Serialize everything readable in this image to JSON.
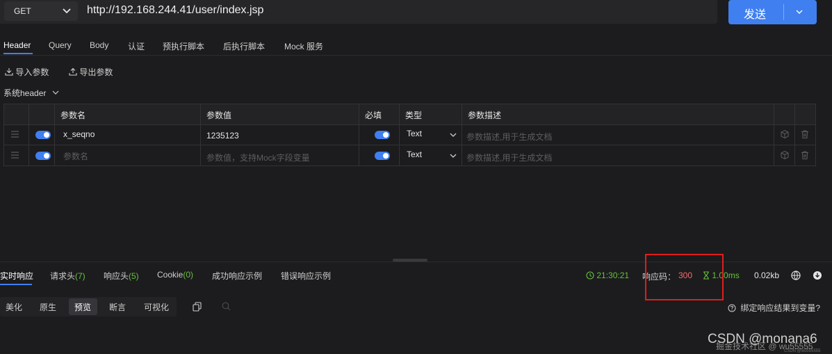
{
  "request": {
    "method": "GET",
    "url": "http://192.168.244.41/user/index.jsp",
    "send_label": "发送"
  },
  "tabs": [
    "Header",
    "Query",
    "Body",
    "认证",
    "预执行脚本",
    "后执行脚本",
    "Mock 服务"
  ],
  "actions": {
    "import_label": "导入参数",
    "export_label": "导出参数"
  },
  "system_header_label": "系统header",
  "table": {
    "headers": {
      "name": "参数名",
      "value": "参数值",
      "required": "必填",
      "type": "类型",
      "desc": "参数描述"
    },
    "rows": [
      {
        "name": "x_seqno",
        "value": "1235123",
        "type": "Text",
        "desc_placeholder": "参数描述,用于生成文档"
      },
      {
        "name_placeholder": "参数名",
        "value_placeholder": "参数值，支持Mock字段变量",
        "type": "Text",
        "desc_placeholder": "参数描述,用于生成文档"
      }
    ]
  },
  "response": {
    "tabs": {
      "realtime": "实时响应",
      "req_headers": "请求头",
      "req_headers_count": "(7)",
      "resp_headers": "响应头",
      "resp_headers_count": "(5)",
      "cookie": "Cookie",
      "cookie_count": "(0)",
      "success_example": "成功响应示例",
      "error_example": "错误响应示例"
    },
    "time": "21:30:21",
    "code_label": "响应码：",
    "code_value": "300",
    "duration": "1.00ms",
    "size": "0.02kb",
    "view_tabs": [
      "美化",
      "原生",
      "预览",
      "断言",
      "可视化"
    ],
    "bind_help": "绑定响应结果到变量?"
  },
  "watermark": {
    "main": "CSDN @monana6",
    "secondary": "掘金技术社区 @ wu55555",
    "small": "CSDN @wu555555"
  },
  "colors": {
    "accent": "#3f7ff0",
    "success": "#67c23a",
    "error": "#f56c6c",
    "highlight_box": "#e01e1e"
  }
}
